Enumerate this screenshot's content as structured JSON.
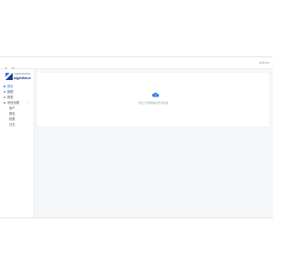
{
  "topbar": {
    "right_text": "admin"
  },
  "logo": {
    "small": "CHINA DIGITAL",
    "big": "digitWave"
  },
  "menu": {
    "items": [
      {
        "label": "首页",
        "active": true
      },
      {
        "label": "数据"
      },
      {
        "label": "报表"
      },
      {
        "label": "系统设置",
        "expandable": true
      }
    ],
    "sub": [
      {
        "label": "用户"
      },
      {
        "label": "角色"
      },
      {
        "label": "权限"
      },
      {
        "label": "日志"
      }
    ]
  },
  "main": {
    "tip": "点击上传或拖拽文件到此处"
  },
  "colors": {
    "accent": "#2b7de9"
  }
}
